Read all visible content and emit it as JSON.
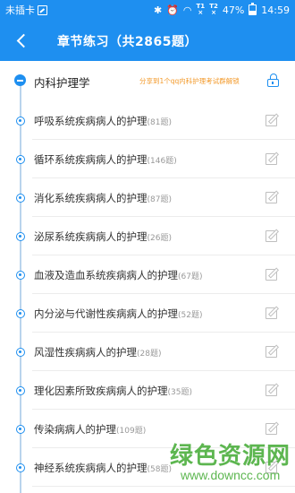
{
  "status_bar": {
    "carrier": "未插卡",
    "sim1": "T1",
    "sim2": "T2",
    "battery": "47%",
    "time": "14:59"
  },
  "app_bar": {
    "title": "章节练习（共2865题）"
  },
  "header": {
    "title": "内科护理学",
    "share_text": "分享到1个qq内科护理考试群解锁"
  },
  "chapters": [
    {
      "label": "呼吸系统疾病病人的护理",
      "count": "(81题)"
    },
    {
      "label": "循环系统疾病病人的护理",
      "count": "(146题)"
    },
    {
      "label": "消化系统疾病病人的护理",
      "count": "(87题)"
    },
    {
      "label": "泌尿系统疾病病人的护理",
      "count": "(26题)"
    },
    {
      "label": "血液及造血系统疾病病人的护理",
      "count": "(67题)"
    },
    {
      "label": "内分泌与代谢性疾病病人的护理",
      "count": "(52题)"
    },
    {
      "label": "风湿性疾病病人的护理",
      "count": "(28题)"
    },
    {
      "label": "理化因素所致疾病病人的护理",
      "count": "(35题)"
    },
    {
      "label": "传染病病人的护理",
      "count": "(109题)"
    },
    {
      "label": "神经系统疾病病人的护理",
      "count": "(58题)"
    }
  ],
  "watermark": {
    "cn": "绿色资源网",
    "en": "www.downcc.com"
  },
  "colors": {
    "primary": "#1e8ff0",
    "share": "#f39a2b",
    "watermark": "#4caf3e"
  }
}
